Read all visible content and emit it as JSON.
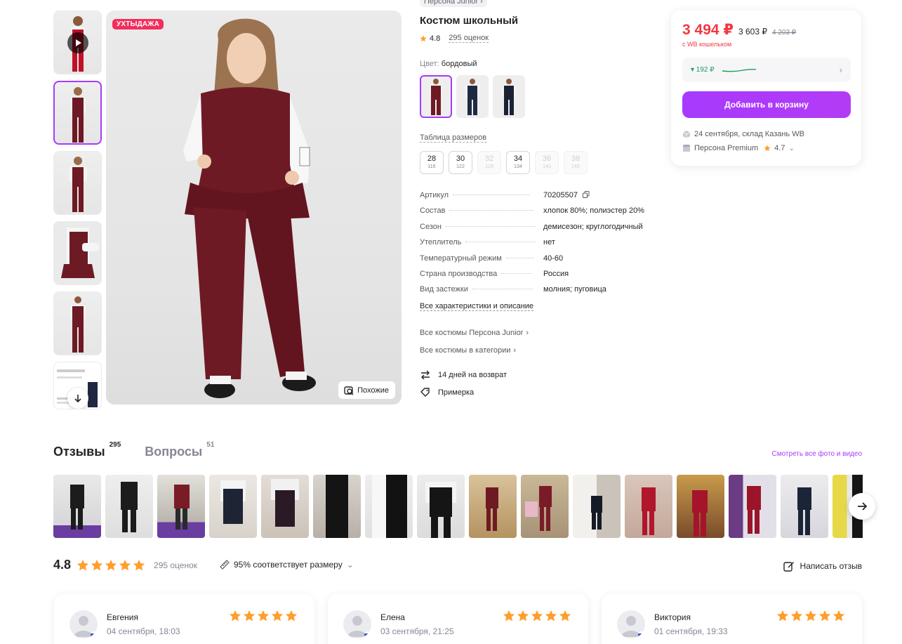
{
  "gallery": {
    "badge": "УХТЫДАЖА",
    "similar_label": "Похожие"
  },
  "product": {
    "breadcrumb": "Персона Junior",
    "title": "Костюм школьный",
    "rating": "4.8",
    "rating_count": "295 оценок",
    "color_key": "Цвет:",
    "color_value": "бордовый",
    "size_table_link": "Таблица размеров",
    "sizes": [
      {
        "ru": "28",
        "height": "116",
        "available": true
      },
      {
        "ru": "30",
        "height": "122",
        "available": true
      },
      {
        "ru": "32",
        "height": "128",
        "available": false
      },
      {
        "ru": "34",
        "height": "134",
        "available": true
      },
      {
        "ru": "36",
        "height": "140",
        "available": false
      },
      {
        "ru": "38",
        "height": "146",
        "available": false
      }
    ],
    "specs": [
      {
        "key": "Артикул",
        "value": "70205507"
      },
      {
        "key": "Состав",
        "value": "хлопок 80%; полиэстер 20%"
      },
      {
        "key": "Сезон",
        "value": "демисезон; круглогодичный"
      },
      {
        "key": "Утеплитель",
        "value": "нет"
      },
      {
        "key": "Температурный режим",
        "value": "40-60"
      },
      {
        "key": "Страна производства",
        "value": "Россия"
      },
      {
        "key": "Вид застежки",
        "value": "молния; пуговица"
      }
    ],
    "all_specs_link": "Все характеристики и описание",
    "brand_link": "Все костюмы Персона Junior",
    "category_link": "Все костюмы в категории",
    "return_label": "14 дней на возврат",
    "fitting_label": "Примерка"
  },
  "buy": {
    "price": "3 494 ₽",
    "price_mid": "3 603 ₽",
    "price_old": "4 203 ₽",
    "wallet_note": "с WB кошельком",
    "installment": "▾ 192 ₽",
    "cart_button": "Добавить в корзину",
    "delivery": "24 сентября, склад Казань WB",
    "seller": "Персона Premium",
    "seller_rating": "4.7"
  },
  "reviews": {
    "tab_reviews": "Отзывы",
    "tab_reviews_count": "295",
    "tab_questions": "Вопросы",
    "tab_questions_count": "51",
    "see_all": "Смотреть все фото и видео",
    "score": "4.8",
    "count": "295 оценок",
    "fit": "95% соответствует размеру",
    "write": "Написать отзыв",
    "items": [
      {
        "name": "Евгения",
        "date": "04 сентября, 18:03",
        "stars": 5
      },
      {
        "name": "Елена",
        "date": "03 сентября, 21:25",
        "stars": 5
      },
      {
        "name": "Виктория",
        "date": "01 сентября, 19:33",
        "stars": 5
      }
    ]
  },
  "colors": {
    "accent": "#a73afd",
    "price": "#f23841",
    "star": "#ff9e2c",
    "burgundy": "#6e1a24"
  }
}
